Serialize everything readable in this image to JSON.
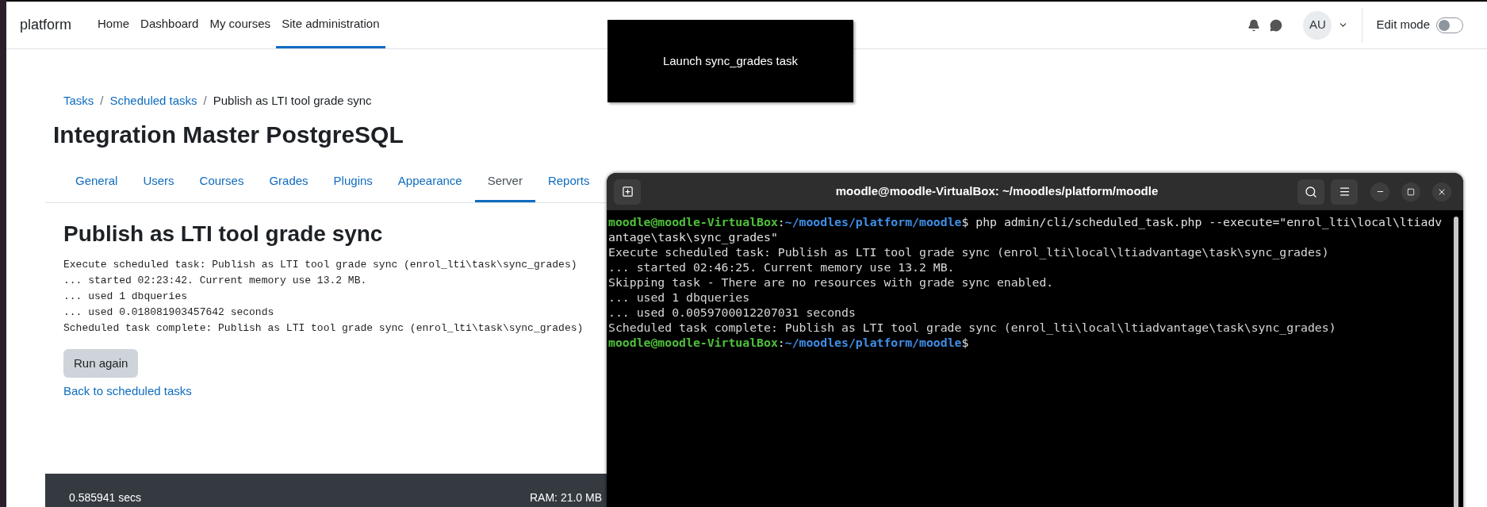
{
  "nav": {
    "brand": "platform",
    "links": [
      {
        "label": "Home",
        "selected": false
      },
      {
        "label": "Dashboard",
        "selected": false
      },
      {
        "label": "My courses",
        "selected": false
      },
      {
        "label": "Site administration",
        "selected": true
      }
    ],
    "avatar": "AU",
    "edit_mode": {
      "label": "Edit mode",
      "on": false
    }
  },
  "popup": {
    "text": "Launch sync_grades task"
  },
  "breadcrumb": [
    {
      "label": "Tasks",
      "kind": "link"
    },
    {
      "label": "Scheduled tasks",
      "kind": "link"
    },
    {
      "label": "Publish as LTI tool grade sync",
      "kind": "current"
    }
  ],
  "breadcrumb_separator": "/",
  "site_title": "Integration Master PostgreSQL",
  "tabs": [
    {
      "label": "General",
      "selected": false
    },
    {
      "label": "Users",
      "selected": false
    },
    {
      "label": "Courses",
      "selected": false
    },
    {
      "label": "Grades",
      "selected": false
    },
    {
      "label": "Plugins",
      "selected": false
    },
    {
      "label": "Appearance",
      "selected": false
    },
    {
      "label": "Server",
      "selected": true
    },
    {
      "label": "Reports",
      "selected": false
    }
  ],
  "page_heading": "Publish as LTI tool grade sync",
  "output_lines": [
    "Execute scheduled task: Publish as LTI tool grade sync (enrol_lti\\task\\sync_grades)",
    "... started 02:23:42. Current memory use 13.2 MB.",
    "... used 1 dbqueries",
    "... used 0.018081903457642 seconds",
    "Scheduled task complete: Publish as LTI tool grade sync (enrol_lti\\task\\sync_grades)"
  ],
  "run_again_button": "Run again",
  "back_link": "Back to scheduled tasks",
  "footer": {
    "time": "0.585941 secs",
    "ram": "RAM: 21.0 MB"
  },
  "terminal": {
    "title": "moodle@moodle-VirtualBox: ~/moodles/platform/moodle",
    "lines": [
      {
        "kind": "prompt",
        "user": "moodle@moodle-VirtualBox",
        "separator": ":",
        "path": "~/moodles/platform/moodle",
        "sign": "$",
        "command": "php admin/cli/scheduled_task.php --execute=\"enrol_lti\\local\\ltiadvantage\\task\\sync_grades\""
      },
      {
        "kind": "output",
        "text": "Execute scheduled task: Publish as LTI tool grade sync (enrol_lti\\local\\ltiadvantage\\task\\sync_grades)"
      },
      {
        "kind": "output",
        "text": "... started 02:46:25. Current memory use 13.2 MB."
      },
      {
        "kind": "output",
        "text": "Skipping task - There are no resources with grade sync enabled."
      },
      {
        "kind": "output",
        "text": "... used 1 dbqueries"
      },
      {
        "kind": "output",
        "text": "... used 0.0059700012207031 seconds"
      },
      {
        "kind": "output",
        "text": "Scheduled task complete: Publish as LTI tool grade sync (enrol_lti\\local\\ltiadvantage\\task\\sync_grades)"
      },
      {
        "kind": "prompt",
        "user": "moodle@moodle-VirtualBox",
        "separator": ":",
        "path": "~/moodles/platform/moodle",
        "sign": "$"
      }
    ]
  }
}
